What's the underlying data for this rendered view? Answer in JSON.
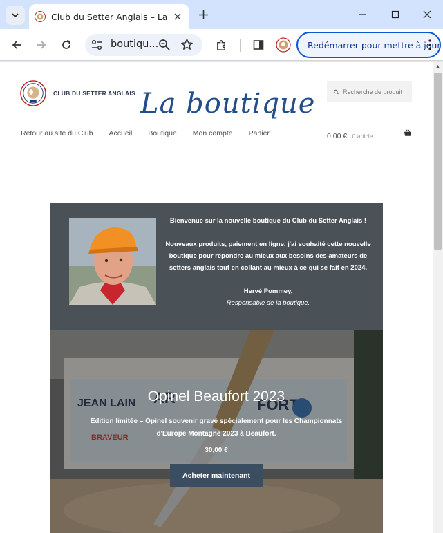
{
  "browser": {
    "tab": {
      "title": "Club du Setter Anglais – La Boutique"
    },
    "omnibox": {
      "url": "boutiqu..."
    },
    "update_button": "Redémarrer pour mettre à jour"
  },
  "site": {
    "name": "CLUB DU SETTER ANGLAIS",
    "title": "La boutique",
    "search_placeholder": "Recherche de produit",
    "nav": [
      "Retour au site du Club",
      "Accueil",
      "Boutique",
      "Mon compte",
      "Panier"
    ],
    "cart": {
      "amount": "0,00 €",
      "count": "0 article"
    }
  },
  "welcome": {
    "line1": "Bienvenue sur la nouvelle boutique du Club du Setter Anglais !",
    "line2": "Nouveaux produits, paiement en ligne, j'ai souhaité cette nouvelle",
    "line3": "boutique pour répondre au mieux aux besoins des amateurs de",
    "line4": "setters anglais tout en collant au mieux à ce qui se fait en 2024.",
    "signature": "Hervé Pommey,",
    "role": "Responsable de la boutique."
  },
  "hero": {
    "title": "Opinel Beaufort 2023",
    "desc1": "Edition limitée – Opinel souvenir gravé spécialement pour les Championnats",
    "desc2": "d'Europe Montagne 2023 à Beaufort.",
    "price": "30,00 €",
    "button": "Acheter maintenant"
  }
}
